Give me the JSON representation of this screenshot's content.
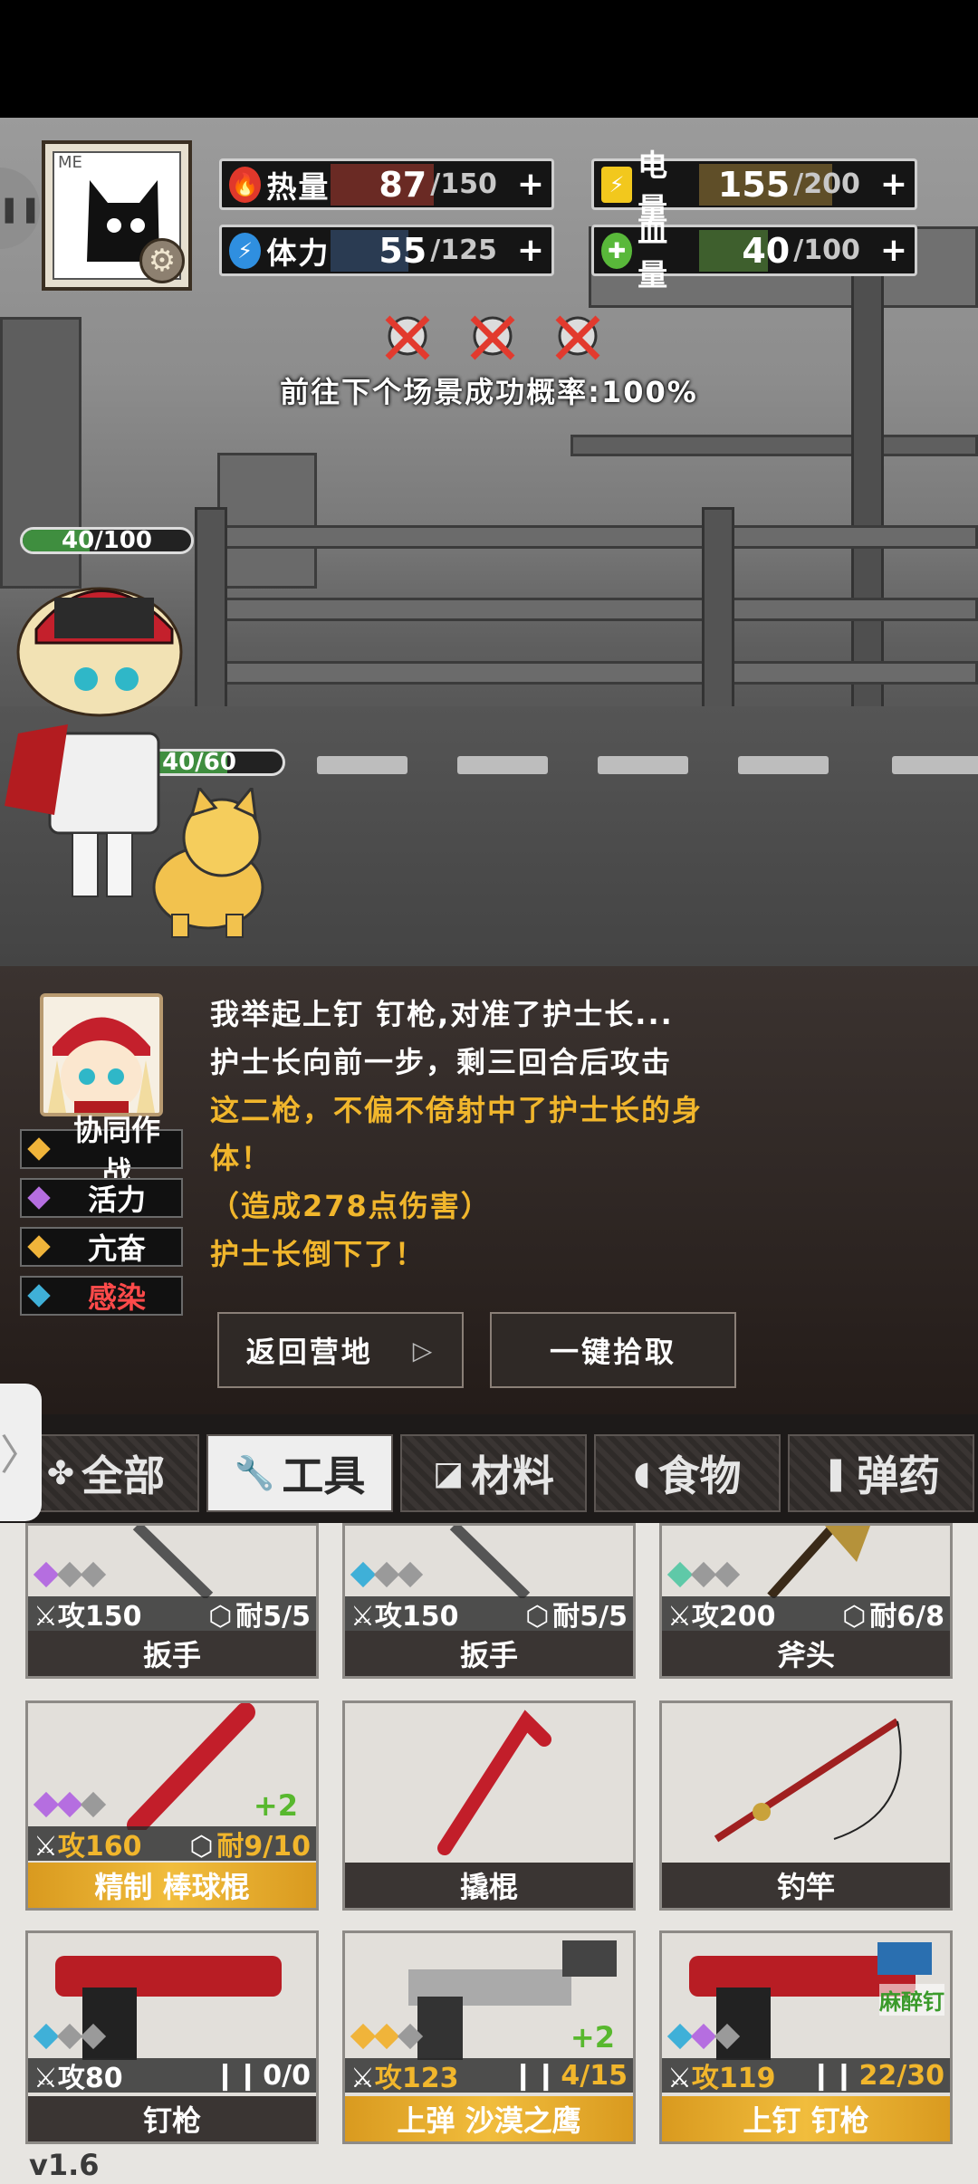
{
  "hud": {
    "stats": [
      {
        "icon": "flame-icon",
        "label": "热量",
        "current": "87",
        "max": "/150",
        "plus": "+",
        "color": "#e0382b",
        "fill": "#6a2a24",
        "level": 0.58
      },
      {
        "icon": "battery-icon",
        "label": "电量",
        "current": "155",
        "max": "/200",
        "plus": "+",
        "color": "#f2c81d",
        "fill": "#5f4e28",
        "level": 0.775
      },
      {
        "icon": "lightning-icon",
        "label": "体力",
        "current": "55",
        "max": "/125",
        "plus": "+",
        "color": "#2f8fe0",
        "fill": "#2a3b52",
        "level": 0.44
      },
      {
        "icon": "blood-drop-icon",
        "label": "血量",
        "current": "40",
        "max": "/100",
        "plus": "+",
        "color": "#59b83a",
        "fill": "#3e5f2d",
        "level": 0.4
      }
    ],
    "avatar_tag": "ME",
    "success_rate": "前往下个场景成功概率:100%"
  },
  "battle": {
    "player_hp": "40/100",
    "player_hp_level": 0.4,
    "pet_hp": "40/60",
    "pet_hp_level": 0.67
  },
  "log": {
    "lines": [
      {
        "text": "我举起上钉 钉枪,对准了护士长...",
        "color": "#ffffff"
      },
      {
        "text": "护士长向前一步，剩三回合后攻击",
        "color": "#ffffff"
      },
      {
        "text": "这二枪，不偏不倚射中了护士长的身",
        "color": "#f1b62c"
      },
      {
        "text": "体！",
        "color": "#f1b62c"
      },
      {
        "text": "（造成278点伤害）",
        "color": "#f1b62c"
      },
      {
        "text": "护士长倒下了！",
        "color": "#f1b62c"
      }
    ],
    "buffs": [
      {
        "label": "协同作战",
        "diamond": "#f0b43a",
        "color": "#ffffff"
      },
      {
        "label": "活力",
        "diamond": "#b56ee0",
        "color": "#ffffff"
      },
      {
        "label": "亢奋",
        "diamond": "#f0b43a",
        "color": "#ffffff"
      },
      {
        "label": "感染",
        "diamond": "#3fb0d8",
        "color": "#ff4a4a"
      }
    ],
    "return_button": "返回营地",
    "pickup_button": "一键拾取"
  },
  "tabs": [
    {
      "label": "全部",
      "icon": "clover-icon",
      "glyph": "✤"
    },
    {
      "label": "工具",
      "icon": "wrench-icon",
      "glyph": "🔧"
    },
    {
      "label": "材料",
      "icon": "material-icon",
      "glyph": "◪"
    },
    {
      "label": "食物",
      "icon": "food-icon",
      "glyph": "◖"
    },
    {
      "label": "弹药",
      "icon": "bullet-icon",
      "glyph": "❚"
    }
  ],
  "items": [
    {
      "name": "扳手",
      "atk": "攻150",
      "dur": "耐5/5",
      "gems": [
        "#b56ee0",
        "#9a9a9a",
        "#9a9a9a"
      ],
      "gold": false,
      "plus": "",
      "badge": ""
    },
    {
      "name": "扳手",
      "atk": "攻150",
      "dur": "耐5/5",
      "gems": [
        "#3fb0d8",
        "#9a9a9a",
        "#9a9a9a"
      ],
      "gold": false,
      "plus": "",
      "badge": ""
    },
    {
      "name": "斧头",
      "atk": "攻200",
      "dur": "耐6/8",
      "gems": [
        "#5fc9a8",
        "#9a9a9a",
        "#9a9a9a"
      ],
      "gold": false,
      "plus": "",
      "badge": ""
    },
    {
      "name": "精制 棒球棍",
      "atk": "攻160",
      "dur": "耐9/10",
      "gems": [
        "#b56ee0",
        "#b56ee0",
        "#9a9a9a"
      ],
      "gold": true,
      "plus": "+2",
      "badge": ""
    },
    {
      "name": "撬棍",
      "atk": "",
      "dur": "",
      "gems": [],
      "gold": false,
      "plus": "",
      "badge": ""
    },
    {
      "name": "钓竿",
      "atk": "",
      "dur": "",
      "gems": [],
      "gold": false,
      "plus": "",
      "badge": ""
    },
    {
      "name": "钉枪",
      "atk": "攻80",
      "dur": "0/0",
      "gems": [
        "#3fb0d8",
        "#9a9a9a",
        "#9a9a9a"
      ],
      "gold": false,
      "plus": "",
      "badge": ""
    },
    {
      "name": "上弹 沙漠之鹰",
      "atk": "攻123",
      "dur": "4/15",
      "gems": [
        "#f0b43a",
        "#f0b43a",
        "#9a9a9a"
      ],
      "gold": true,
      "plus": "+2",
      "badge": ""
    },
    {
      "name": "上钉 钉枪",
      "atk": "攻119",
      "dur": "22/30",
      "gems": [
        "#3fb0d8",
        "#b56ee0",
        "#9a9a9a"
      ],
      "gold": true,
      "plus": "",
      "badge": "麻醉钉"
    }
  ],
  "version": "v1.6"
}
